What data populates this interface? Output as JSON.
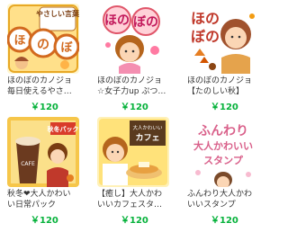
{
  "stickers": [
    {
      "title_line1": "ほのぼのカノジョ",
      "title_line2": "毎日使えるやさ…",
      "price": "￥120",
      "art_text": "やさしい言葉",
      "art_big": "ほのぼの",
      "accent": "#e8a825"
    },
    {
      "title_line1": "ほのぼのカノジョ",
      "title_line2": "☆女子力up ぷつ…",
      "price": "￥120",
      "art_text": "ほのぼの",
      "accent": "#e0566a"
    },
    {
      "title_line1": "ほのぼのカノジョ",
      "title_line2": "【たのしい秋】",
      "price": "￥120",
      "art_text": "ほのぼの",
      "accent": "#a33f1e"
    },
    {
      "title_line1": "秋冬❤大人かわい",
      "title_line2": "い日常パック",
      "price": "￥120",
      "art_text": "秋冬パック",
      "art_small": "CAFE",
      "accent": "#d93b2a"
    },
    {
      "title_line1": "【癒し】大人かわ",
      "title_line2": "いいカフェスタ…",
      "price": "￥120",
      "art_text": "大人かわいいカフェ",
      "accent": "#e8b34a"
    },
    {
      "title_line1": "ふんわり大人かわ",
      "title_line2": "いいスタンプ",
      "price": "￥120",
      "art_text": "ふんわり大人かわいいスタンプ",
      "accent": "#d9608a"
    }
  ]
}
